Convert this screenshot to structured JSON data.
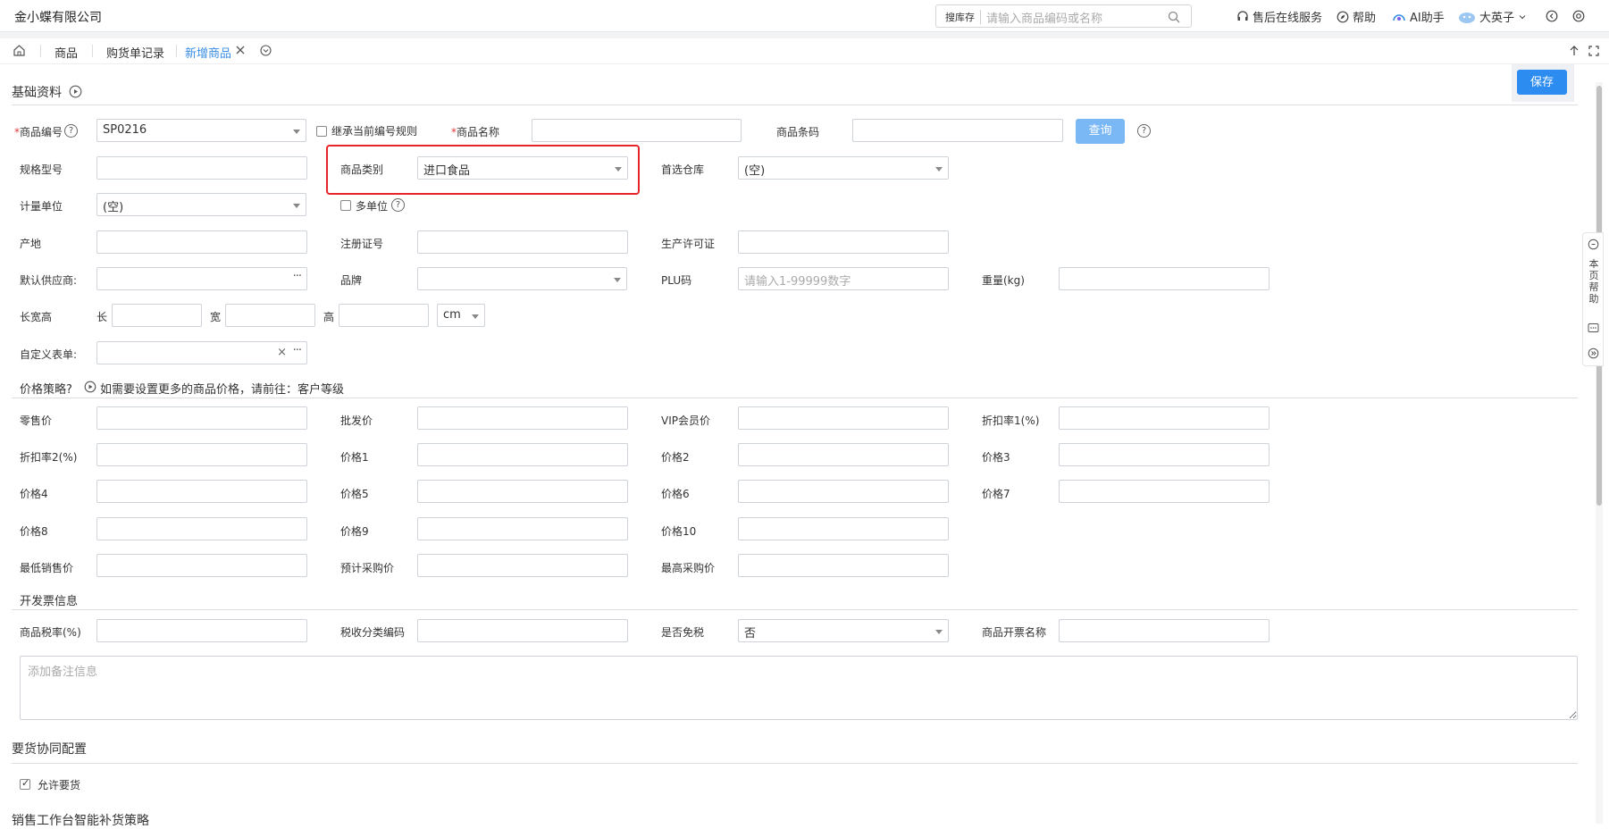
{
  "app": {
    "company": "金小蝶有限公司"
  },
  "search": {
    "tag": "搜库存",
    "placeholder": "请输入商品编码或名称"
  },
  "topnav": {
    "service": "售后在线服务",
    "help": "帮助",
    "ai": "AI助手",
    "user": "大英子"
  },
  "tabs": [
    {
      "label": "商品"
    },
    {
      "label": "购货单记录"
    },
    {
      "label": "新增商品"
    }
  ],
  "toolbar": {
    "save": "保存"
  },
  "sections": {
    "basic": "基础资料",
    "price": "价格策略?",
    "price_hint": "如需要设置更多的商品价格，请前往：客户等级",
    "invoice": "开发票信息",
    "requisition": "要货协同配置",
    "replenish": "销售工作台智能补货策略"
  },
  "basic": {
    "code_label": "商品编号",
    "code_value": "SP0216",
    "inherit_label": "继承当前编号规则",
    "name_label": "商品名称",
    "barcode_label": "商品条码",
    "query_btn": "查询",
    "spec_label": "规格型号",
    "category_label": "商品类别",
    "category_value": "进口食品",
    "warehouse_label": "首选仓库",
    "warehouse_value": "(空)",
    "unit_label": "计量单位",
    "unit_value": "(空)",
    "multi_unit_label": "多单位",
    "origin_label": "产地",
    "reg_label": "注册证号",
    "license_label": "生产许可证",
    "supplier_label": "默认供应商:",
    "brand_label": "品牌",
    "plu_label": "PLU码",
    "plu_placeholder": "请输入1-99999数字",
    "weight_label": "重量(kg)",
    "dims_label": "长宽高",
    "len_label": "长",
    "wid_label": "宽",
    "hei_label": "高",
    "dims_unit": "cm",
    "custom_label": "自定义表单:"
  },
  "price": {
    "retail": "零售价",
    "wholesale": "批发价",
    "vip": "VIP会员价",
    "discount1": "折扣率1(%)",
    "discount2": "折扣率2(%)",
    "p1": "价格1",
    "p2": "价格2",
    "p3": "价格3",
    "p4": "价格4",
    "p5": "价格5",
    "p6": "价格6",
    "p7": "价格7",
    "p8": "价格8",
    "p9": "价格9",
    "p10": "价格10",
    "min_sale": "最低销售价",
    "est_purchase": "预计采购价",
    "max_purchase": "最高采购价"
  },
  "invoice": {
    "tax_rate": "商品税率(%)",
    "tax_code": "税收分类编码",
    "tax_free": "是否免税",
    "tax_free_value": "否",
    "invoice_name": "商品开票名称",
    "note_placeholder": "添加备注信息"
  },
  "requisition": {
    "allow": "允许要货"
  },
  "sidehelp": {
    "label": "本页帮助"
  }
}
